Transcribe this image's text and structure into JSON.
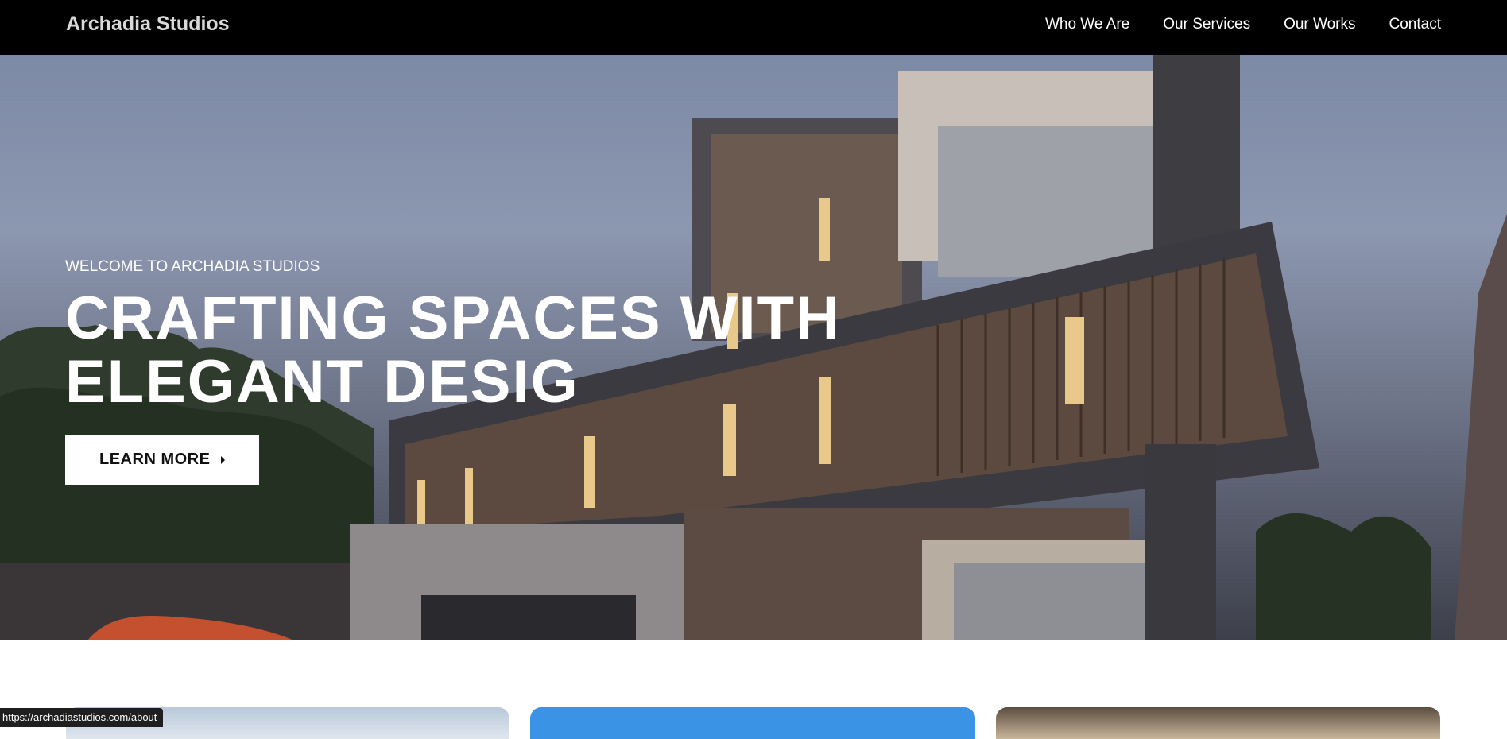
{
  "navbar": {
    "brand": "Archadia Studios",
    "links": [
      "Who We Are",
      "Our Services",
      "Our Works",
      "Contact"
    ]
  },
  "hero": {
    "eyebrow": "WELCOME TO ARCHADIA STUDIOS",
    "headline_line1": "CRAFTING SPACES WITH",
    "headline_line2": "ELEGANT DESIG",
    "cta_label": "LEARN MORE"
  },
  "status_bar": {
    "url": "https://archadiastudios.com/about"
  },
  "colors": {
    "nav_bg": "#000000",
    "brand_text": "#d9d9d9",
    "cta_bg": "#ffffff",
    "card_blue": "#3a93e4"
  }
}
